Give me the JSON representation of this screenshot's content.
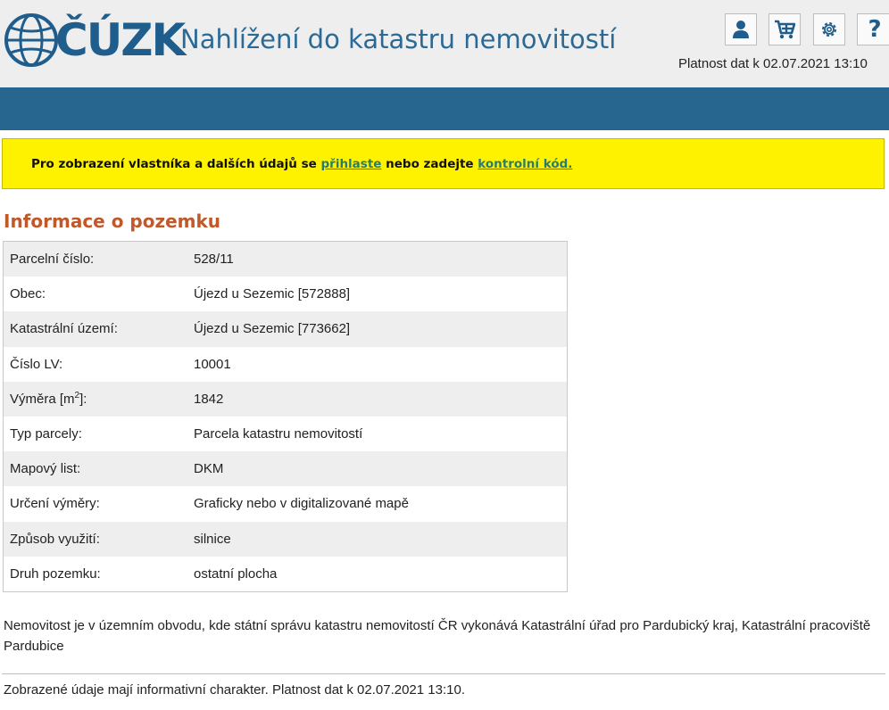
{
  "header": {
    "logo_text": "ČÚZK",
    "app_title": "Nahlížení do katastru nemovitostí",
    "validity": "Platnost dat k 02.07.2021 13:10",
    "toolbar": {
      "user_icon": "user-icon",
      "cart_icon": "cart-icon",
      "settings_icon": "gear-icon",
      "help_label": "?"
    }
  },
  "notice": {
    "prefix": "Pro zobrazení vlastníka a dalších údajů se ",
    "login_link": "přihlaste",
    "middle": " nebo zadejte ",
    "code_link": "kontrolní kód."
  },
  "parcel": {
    "title": "Informace o pozemku",
    "rows": [
      {
        "label": "Parcelní číslo:",
        "value": "528/11"
      },
      {
        "label": "Obec:",
        "value": "Újezd u Sezemic [572888]"
      },
      {
        "label": "Katastrální území:",
        "value": "Újezd u Sezemic [773662]"
      },
      {
        "label": "Číslo LV:",
        "value": "10001"
      },
      {
        "label_main": "Výměra [m",
        "label_sup": "2",
        "label_end": "]:",
        "value": "1842"
      },
      {
        "label": "Typ parcely:",
        "value": "Parcela katastru nemovitostí"
      },
      {
        "label": "Mapový list:",
        "value": "DKM"
      },
      {
        "label": "Určení výměry:",
        "value": "Graficky nebo v digitalizované mapě"
      },
      {
        "label": "Způsob využití:",
        "value": "silnice"
      },
      {
        "label": "Druh pozemku:",
        "value": "ostatní plocha"
      }
    ]
  },
  "office_note": "Nemovitost je v územním obvodu, kde státní správu katastru nemovitostí ČR vykonává Katastrální úřad pro Pardubický kraj, Katastrální pracoviště Pardubice",
  "footer_note": "Zobrazené údaje mají informativní charakter. Platnost dat k 02.07.2021 13:10.",
  "colors": {
    "brand_blue": "#1e5d8c",
    "bar_blue": "#26668f",
    "notice_yellow": "#fff200",
    "section_title": "#c0582a",
    "link": "#2a7c6e"
  }
}
